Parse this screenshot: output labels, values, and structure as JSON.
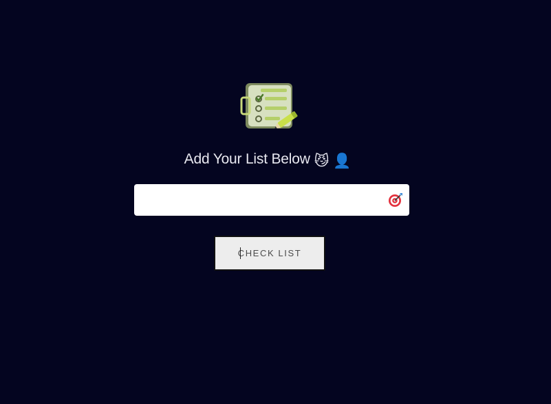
{
  "header": {
    "logo_icon": "checklist-clipboard-icon",
    "title": "Add Your List Below",
    "emojis": [
      "😼",
      "👤"
    ]
  },
  "form": {
    "input_value": "",
    "input_icon": "target-dart-icon",
    "submit_label": "CHECK LIST"
  },
  "colors": {
    "background": "#040520",
    "heading_text": "#e8e8f0",
    "input_bg": "#ffffff",
    "button_bg": "#ededed",
    "button_border": "#111111"
  }
}
